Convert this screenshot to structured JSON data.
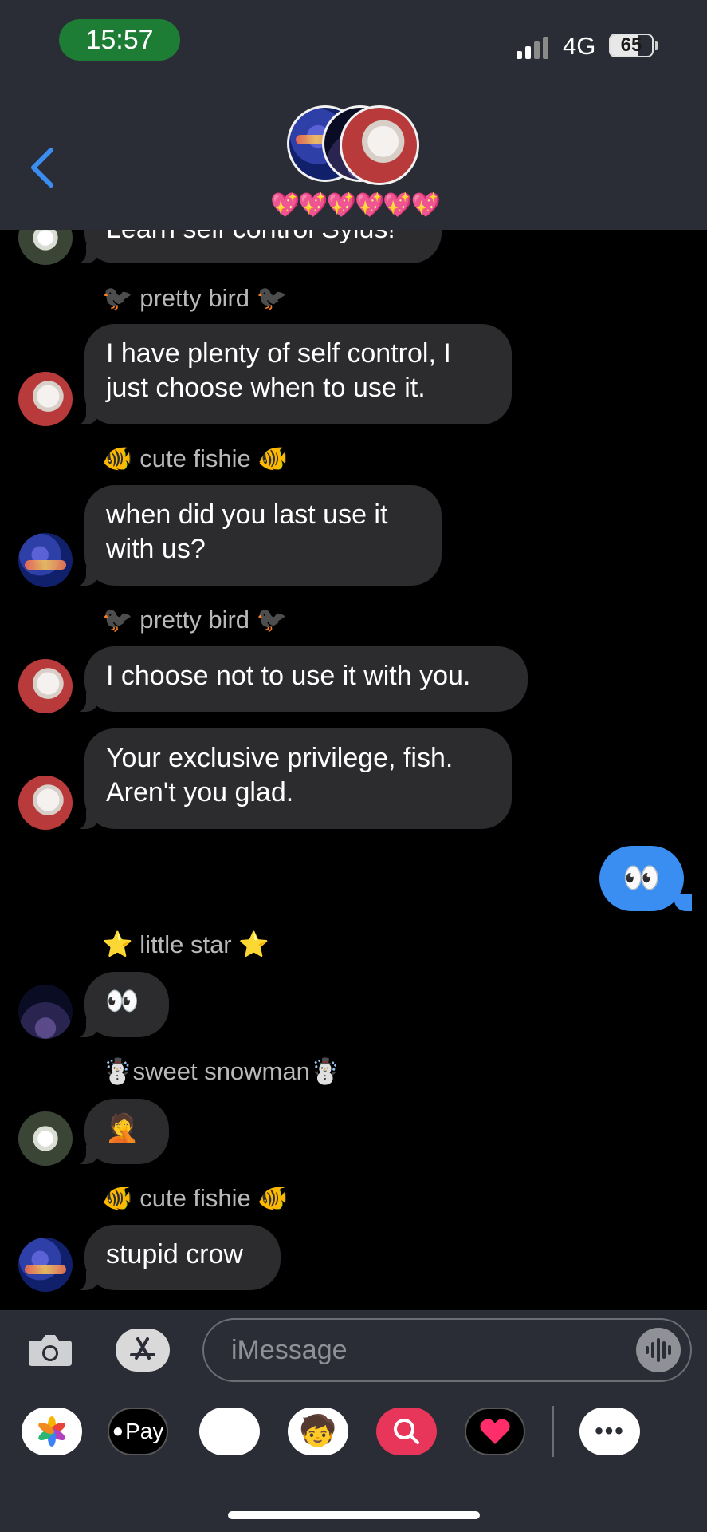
{
  "status_bar": {
    "time": "15:57",
    "network": "4G",
    "battery": "65"
  },
  "header": {
    "group_name": "💖💖💖💖💖💖"
  },
  "messages": [
    {
      "sender": "",
      "text": "Learn self control Sylus!"
    },
    {
      "sender": "🐦‍⬛ pretty bird 🐦‍⬛",
      "text": "I have plenty of self control, I just choose when to use it."
    },
    {
      "sender": "🐠 cute fishie 🐠",
      "text": "when did you last use it with us?"
    },
    {
      "sender": "🐦‍⬛ pretty bird 🐦‍⬛",
      "text": "I choose not to use it with you."
    },
    {
      "sender": "",
      "text": "Your exclusive privilege, fish. Aren't you glad."
    },
    {
      "sender": "",
      "text": "👀",
      "outgoing": true
    },
    {
      "sender": "⭐ little star ⭐",
      "text": "👀"
    },
    {
      "sender": "☃️sweet snowman☃️",
      "text": "🤦"
    },
    {
      "sender": "🐠 cute fishie 🐠",
      "text": "stupid crow"
    }
  ],
  "compose": {
    "placeholder": "iMessage"
  },
  "apps": {
    "apple_pay": "Pay",
    "more": "•••"
  },
  "colors": {
    "header_bg": "#2a2d35",
    "bubble_in": "#2c2c2e",
    "bubble_out": "#3a8ef2",
    "accent": "#3a8ef2",
    "time_pill": "#1e7d34"
  }
}
